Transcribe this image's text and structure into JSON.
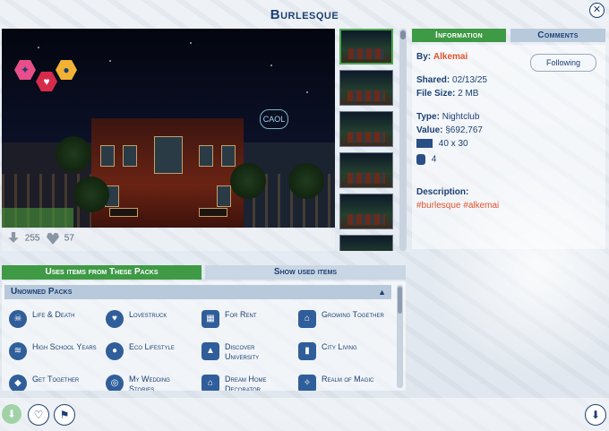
{
  "window": {
    "title": "Burlesque",
    "close_icon": "close-icon"
  },
  "preview": {
    "stats": {
      "downloads": "255",
      "favorites": "57"
    },
    "badge_text": "CAOL"
  },
  "tabs": {
    "information": "Information",
    "comments": "Comments"
  },
  "info": {
    "by_label": "By:",
    "author": "Alkemai",
    "follow_label": "Following",
    "shared_label": "Shared:",
    "shared_value": "02/13/25",
    "size_label": "File Size:",
    "size_value": "2 MB",
    "type_label": "Type:",
    "type_value": "Nightclub",
    "value_label": "Value:",
    "value_value": "§692,767",
    "lot_size": "40 x 30",
    "bathrooms": "4",
    "description_label": "Description:",
    "description_tags": "#burlesque #alkemai"
  },
  "packs_tabs": {
    "uses": "Uses items from These Packs",
    "show": "Show used items"
  },
  "packs": {
    "header": "Unowned Packs",
    "items": [
      {
        "label": "Life & Death",
        "icon": "skull-icon"
      },
      {
        "label": "Lovestruck",
        "icon": "heart-pack-icon"
      },
      {
        "label": "For Rent",
        "icon": "building-icon"
      },
      {
        "label": "Growing Together",
        "icon": "family-icon"
      },
      {
        "label": "High School Years",
        "icon": "book-icon"
      },
      {
        "label": "Eco Lifestyle",
        "icon": "leaf-icon"
      },
      {
        "label": "Discover University",
        "icon": "graduation-icon"
      },
      {
        "label": "City Living",
        "icon": "city-icon"
      },
      {
        "label": "Get Together",
        "icon": "group-icon"
      },
      {
        "label": "My Wedding Stories",
        "icon": "rings-icon"
      },
      {
        "label": "Dream Home Decorator",
        "icon": "house-icon"
      },
      {
        "label": "Realm of Magic",
        "icon": "magic-icon"
      }
    ]
  },
  "colors": {
    "accent_green": "#3e9a45",
    "text_blue": "#1b3f73",
    "author_orange": "#e0522d"
  }
}
